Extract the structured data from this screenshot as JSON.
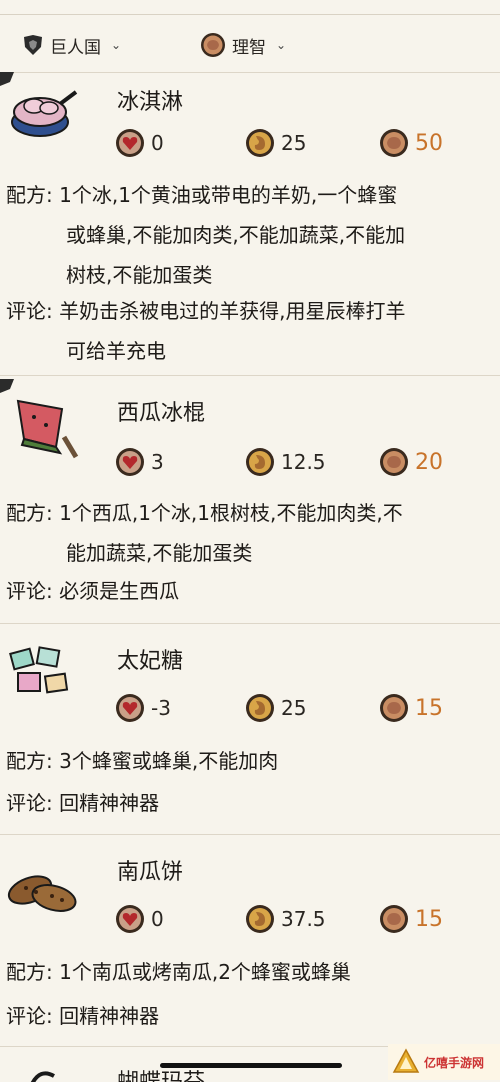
{
  "filters": {
    "world": "巨人国",
    "stat": "理智"
  },
  "recipe_label": "配方:",
  "comment_label": "评论:",
  "items": [
    {
      "name": "冰淇淋",
      "health": "0",
      "hunger": "25",
      "sanity": "50",
      "recipe_lines": [
        "1个冰,1个黄油或带电的羊奶,一个蜂蜜",
        "或蜂巢,不能加肉类,不能加蔬菜,不能加",
        "树枝,不能加蛋类"
      ],
      "comment_lines": [
        "羊奶击杀被电过的羊获得,用星辰棒打羊",
        "可给羊充电"
      ]
    },
    {
      "name": "西瓜冰棍",
      "health": "3",
      "hunger": "12.5",
      "sanity": "20",
      "recipe_lines": [
        "1个西瓜,1个冰,1根树枝,不能加肉类,不",
        "能加蔬菜,不能加蛋类"
      ],
      "comment_lines": [
        "必须是生西瓜"
      ]
    },
    {
      "name": "太妃糖",
      "health": "-3",
      "hunger": "25",
      "sanity": "15",
      "recipe_lines": [
        "3个蜂蜜或蜂巢,不能加肉"
      ],
      "comment_lines": [
        "回精神神器"
      ]
    },
    {
      "name": "南瓜饼",
      "health": "0",
      "hunger": "37.5",
      "sanity": "15",
      "recipe_lines": [
        "1个南瓜或烤南瓜,2个蜂蜜或蜂巢"
      ],
      "comment_lines": [
        "回精神神器"
      ]
    },
    {
      "name": "蝴蝶玛芬"
    }
  ],
  "watermark": {
    "text": "亿嘻手游网"
  },
  "colors": {
    "background": "#f7f4ec",
    "sanity_value": "#c8732a",
    "divider": "#ddd6c8"
  }
}
